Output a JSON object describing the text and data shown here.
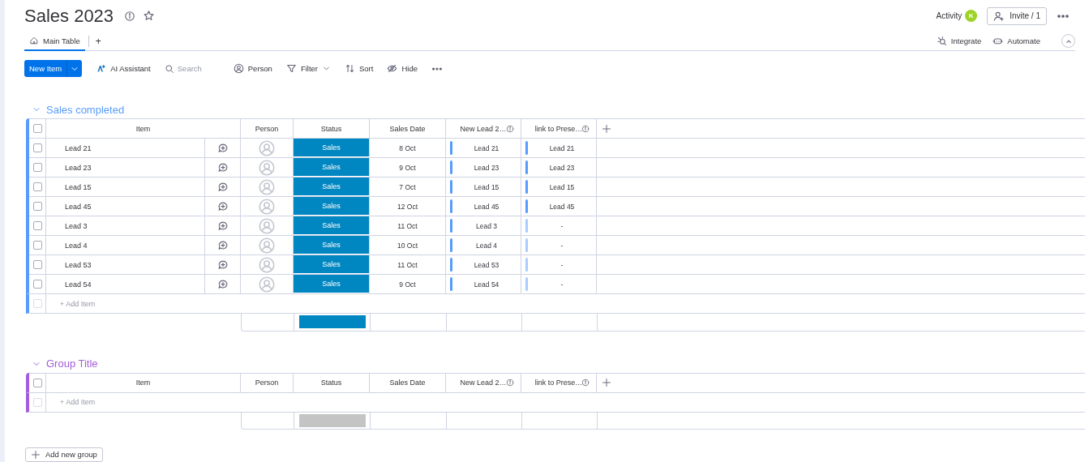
{
  "board": {
    "title": "Sales 2023",
    "activity": {
      "label": "Activity",
      "initial": "K"
    },
    "invite": "Invite / 1"
  },
  "tabs": [
    {
      "label": "Main Table",
      "selected": true
    }
  ],
  "add_tab": "+",
  "views": [
    "Integrate",
    "Automate"
  ],
  "toolbar": {
    "new_item": "New Item",
    "tools": [
      {
        "kind": "ai",
        "label": "AI Assistant"
      },
      {
        "kind": "search",
        "placeholder": "Search"
      },
      {
        "kind": "person",
        "label": "Person"
      },
      {
        "kind": "filter",
        "label": "Filter"
      },
      {
        "kind": "sort",
        "label": "Sort"
      },
      {
        "kind": "hide",
        "label": "Hide"
      }
    ]
  },
  "groups": [
    {
      "title": "Sales completed",
      "color": "#579bfc",
      "expanded": true,
      "checked": false,
      "columns": [
        "Item",
        "Person",
        "Status",
        "Sales Date",
        "New Lead 2…",
        "link to Prese…"
      ],
      "rows": [
        {
          "checked": false,
          "item": "Lead 21",
          "status": "Sales",
          "color": "#0086c0",
          "date": "8 Oct",
          "new_lead": "Lead 21",
          "link": "Lead 21",
          "linked": true
        },
        {
          "checked": false,
          "item": "Lead 23",
          "status": "Sales",
          "color": "#0086c0",
          "date": "9 Oct",
          "new_lead": "Lead 23",
          "link": "Lead 23",
          "linked": true
        },
        {
          "checked": false,
          "item": "Lead 15",
          "status": "Sales",
          "color": "#0086c0",
          "date": "7 Oct",
          "new_lead": "Lead 15",
          "link": "Lead 15",
          "linked": true
        },
        {
          "checked": false,
          "item": "Lead 45",
          "status": "Sales",
          "color": "#0086c0",
          "date": "12 Oct",
          "new_lead": "Lead 45",
          "link": "Lead 45",
          "linked": true
        },
        {
          "checked": false,
          "item": "Lead 3",
          "status": "Sales",
          "color": "#0086c0",
          "date": "11 Oct",
          "new_lead": "Lead 3",
          "link": "-",
          "linked": false
        },
        {
          "checked": false,
          "item": "Lead 4",
          "status": "Sales",
          "color": "#0086c0",
          "date": "10 Oct",
          "new_lead": "Lead 4",
          "link": "-",
          "linked": false
        },
        {
          "checked": false,
          "item": "Lead 53",
          "status": "Sales",
          "color": "#0086c0",
          "date": "11 Oct",
          "new_lead": "Lead 53",
          "link": "-",
          "linked": false
        },
        {
          "checked": false,
          "item": "Lead 54",
          "status": "Sales",
          "color": "#0086c0",
          "date": "9 Oct",
          "new_lead": "Lead 54",
          "link": "-",
          "linked": false
        }
      ],
      "add_row": {
        "label": "+ Add Item",
        "disabled": true
      },
      "summary": {
        "color": "#0086c0"
      }
    },
    {
      "title": "Group Title",
      "color": "#a25ddc",
      "expanded": true,
      "checked": false,
      "columns": [
        "Item",
        "Person",
        "Status",
        "Sales Date",
        "New Lead 2…",
        "link to Prese…"
      ],
      "add_row": {
        "label": "+ Add Item",
        "disabled": true
      },
      "summary": {
        "color": "#c4c4c4"
      }
    }
  ],
  "add_group": "Add new group"
}
